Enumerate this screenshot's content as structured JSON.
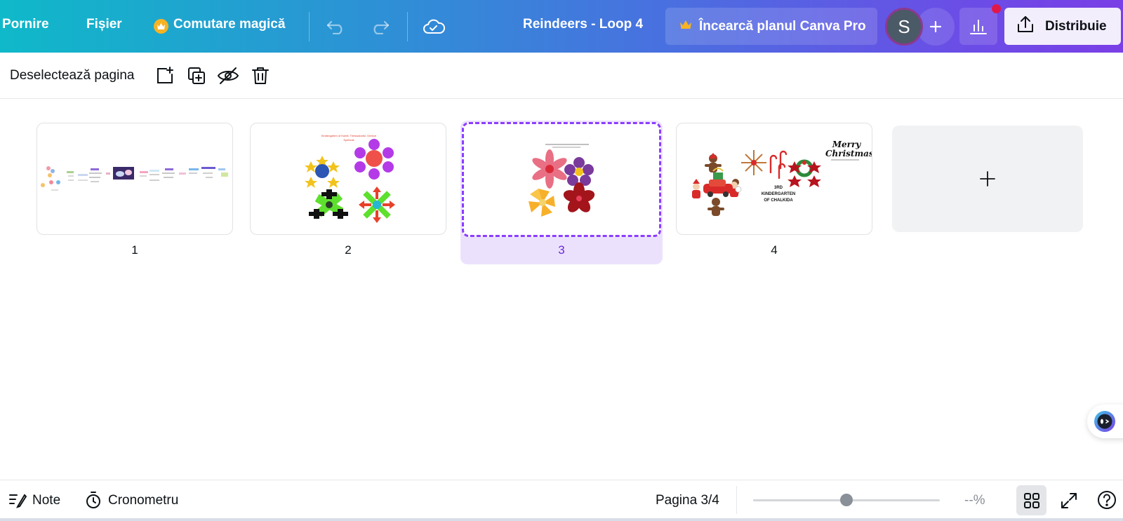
{
  "topbar": {
    "home_label": "Pornire",
    "file_label": "Fișier",
    "magic_switch_label": "Comutare magică",
    "document_title": "Reindeers - Loop 4",
    "pro_cta_label": "Încearcă planul Canva Pro",
    "avatar_initial": "S",
    "share_label": "Distribuie"
  },
  "page_toolbar": {
    "deselect_label": "Deselectează pagina"
  },
  "pages": [
    {
      "number": "1",
      "title": ""
    },
    {
      "number": "2",
      "title": "Kindergarten of Kuteli, Thessaloniki, Greece\nSymbols"
    },
    {
      "number": "3",
      "title": ""
    },
    {
      "number": "4",
      "title": "Merry Christmas!",
      "subtitle": "3RD\nKINDERGARTEN\nOF CHALKIDA"
    }
  ],
  "selected_page": 3,
  "footer": {
    "notes_label": "Note",
    "timer_label": "Cronometru",
    "page_indicator": "Pagina 3/4",
    "zoom_value": "--%"
  },
  "colors": {
    "accent": "#8b3dff",
    "selection_bg": "#ece1fd",
    "crown": "#f6b324",
    "notification": "#e0184a"
  }
}
